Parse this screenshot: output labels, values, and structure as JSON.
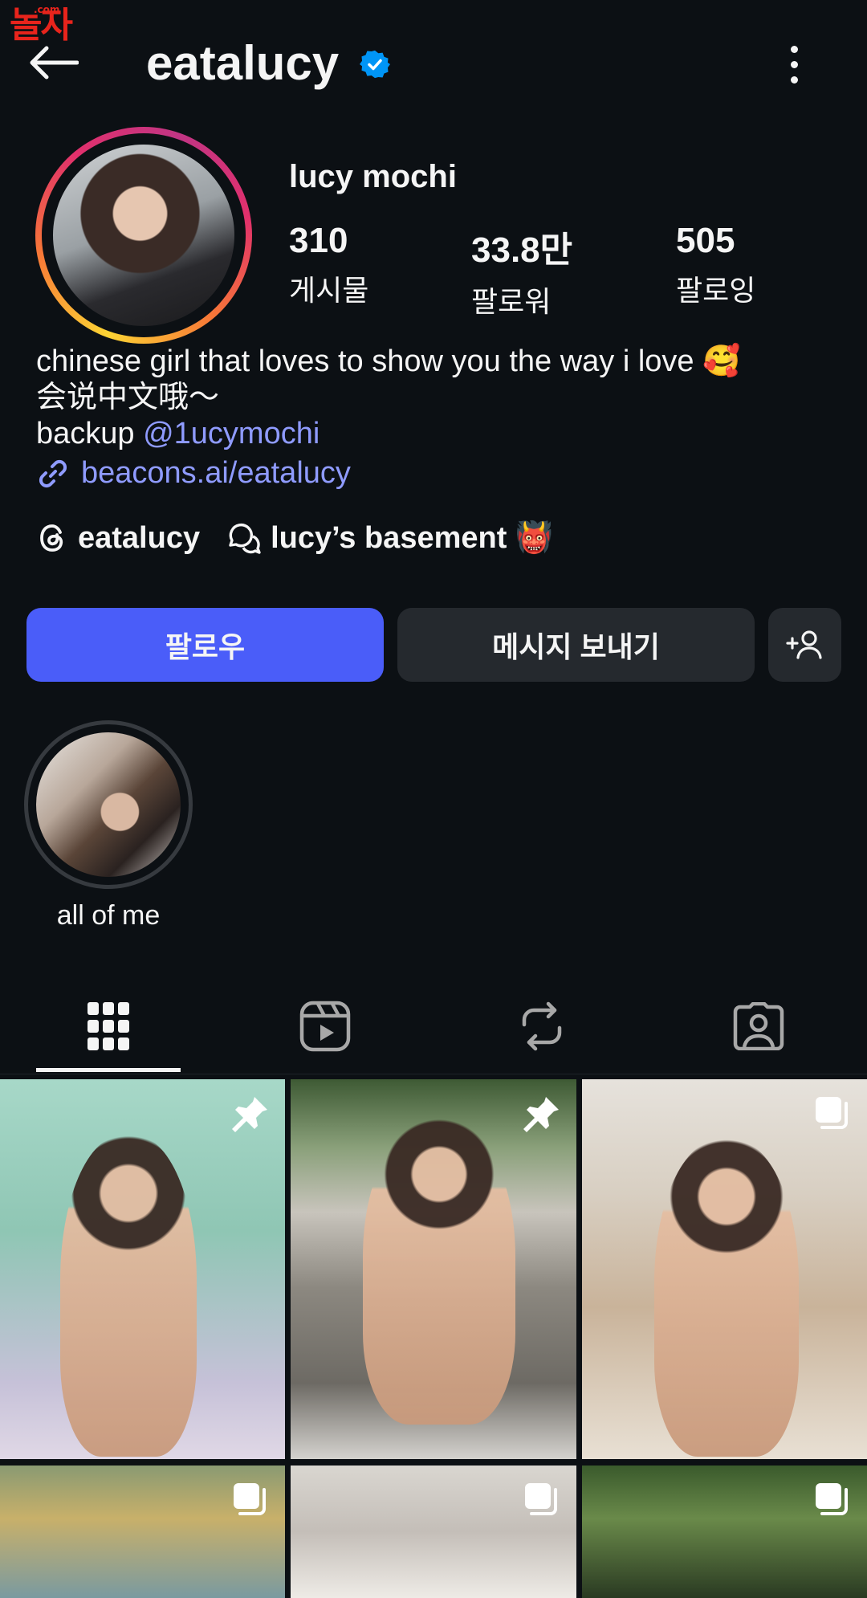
{
  "watermark": {
    "text": "놀자",
    "suffix": ".com"
  },
  "header": {
    "username": "eatalucy",
    "verified": true
  },
  "profile": {
    "display_name": "lucy mochi",
    "stats": [
      {
        "value": "310",
        "label": "게시물"
      },
      {
        "value": "33.8만",
        "label": "팔로워"
      },
      {
        "value": "505",
        "label": "팔로잉"
      }
    ],
    "bio": {
      "line1": "chinese girl that loves to show you the way i love 🥰",
      "line2": "会说中文哦～",
      "line3_prefix": "backup ",
      "line3_mention": "@1ucymochi",
      "link": "beacons.ai/eatalucy"
    },
    "threads": {
      "label": "eatalucy"
    },
    "channel": {
      "label": "lucy’s basement 👹"
    }
  },
  "actions": {
    "follow": "팔로우",
    "message": "메시지 보내기"
  },
  "highlights": [
    {
      "label": "all of me"
    }
  ],
  "tabs": [
    "grid-icon",
    "reels-icon",
    "reposts-icon",
    "tagged-icon"
  ],
  "grid": [
    {
      "badge": "pin-icon"
    },
    {
      "badge": "pin-icon"
    },
    {
      "badge": "carousel-icon"
    },
    {
      "badge": "carousel-icon"
    },
    {
      "badge": "carousel-icon"
    },
    {
      "badge": "carousel-icon"
    }
  ],
  "colors": {
    "accent": "#4a5df9",
    "link": "#8f9bff",
    "background": "#0c1014",
    "button": "#25292e"
  }
}
